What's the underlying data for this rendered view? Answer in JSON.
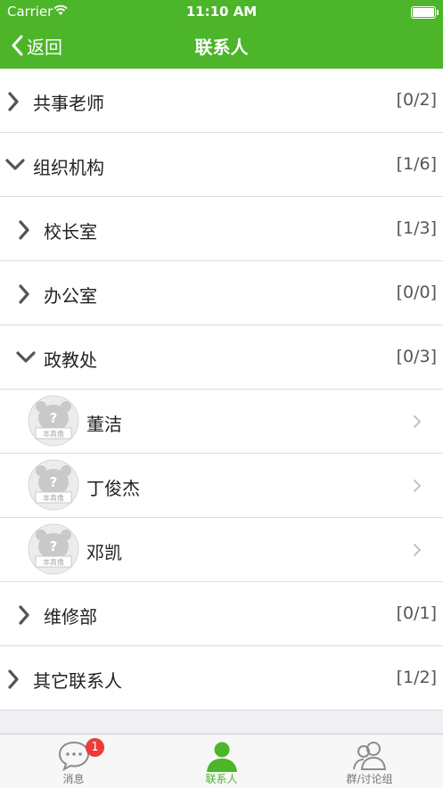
{
  "status_bar": {
    "carrier": "Carrier",
    "time": "11:10 AM"
  },
  "nav": {
    "back_label": "返回",
    "title": "联系人"
  },
  "rows": [
    {
      "label": "共事老师",
      "count": "[0/2]"
    },
    {
      "label": "组织机构",
      "count": "[1/6]"
    },
    {
      "label": "校长室",
      "count": "[1/3]"
    },
    {
      "label": "办公室",
      "count": "[0/0]"
    },
    {
      "label": "政教处",
      "count": "[0/3]"
    },
    {
      "label": "董洁"
    },
    {
      "label": "丁俊杰"
    },
    {
      "label": "邓凯"
    },
    {
      "label": "维修部",
      "count": "[0/1]"
    },
    {
      "label": "其它联系人",
      "count": "[1/2]"
    }
  ],
  "avatar_placeholder_text": "本真像",
  "tabs": [
    {
      "label": "消息",
      "badge": "1"
    },
    {
      "label": "联系人"
    },
    {
      "label": "群/讨论组"
    }
  ],
  "colors": {
    "brand": "#4cb52a",
    "badge": "#ee3a3a"
  },
  "icons": [
    "chevron-right-icon",
    "chevron-down-icon",
    "wifi-icon",
    "battery-icon",
    "chat-icon",
    "person-icon",
    "group-icon",
    "back-chevron-icon"
  ]
}
